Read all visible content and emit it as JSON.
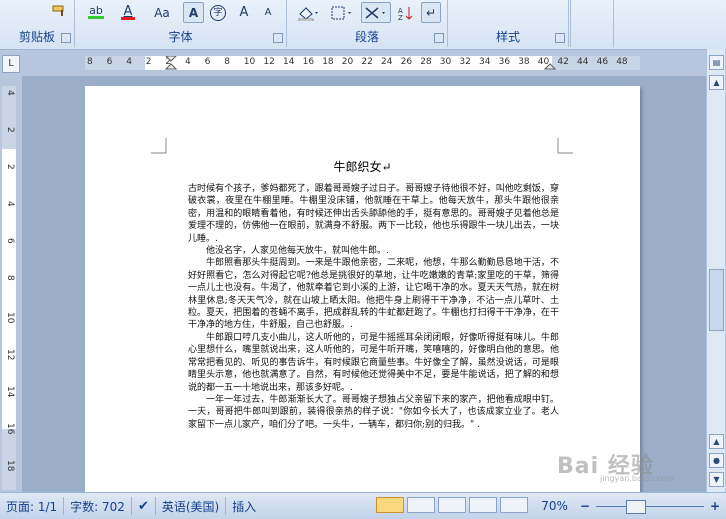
{
  "ribbon": {
    "groups": {
      "clipboard": "剪贴板",
      "font": "字体",
      "paragraph": "段落",
      "styles": "样式"
    },
    "font_buttons": {
      "highlight": "ab",
      "font_color": "A",
      "change_case": "Aa",
      "char_shading": "A",
      "enclose": "字",
      "grow": "A",
      "shrink": "A"
    }
  },
  "ruler": {
    "h_numbers": [
      "8",
      "6",
      "4",
      "2",
      "2",
      "4",
      "6",
      "8",
      "10",
      "12",
      "14",
      "16",
      "18",
      "20",
      "22",
      "24",
      "26",
      "28",
      "30",
      "32",
      "34",
      "36",
      "38",
      "40",
      "42",
      "44",
      "46",
      "48"
    ],
    "v_numbers": [
      "4",
      "2",
      "2",
      "4",
      "6",
      "8",
      "10",
      "12",
      "14",
      "16",
      "18"
    ],
    "corner_label": "L"
  },
  "document": {
    "title": "牛郎织女↵",
    "paragraphs": [
      "古时候有个孩子，爹妈都死了，跟着哥哥嫂子过日子。哥哥嫂子待他很不好，叫他吃剩饭，穿破衣裳，夜里在牛棚里睡。牛棚里没床铺，他就睡在干草上。他每天放牛，那头牛跟他很亲密，用温和的眼睛看着他，有时候还伸出舌头舔舔他的手，挺有意思的。哥哥嫂子见着他总是爱理不理的，仿佛他一在眼前，就满身不舒服。两下一比较，他也乐得跟牛一块儿出去，一块儿睡。.",
      "他没名字，人家见他每天放牛，就叫他牛郎。.",
      "牛郎照看那头牛挺周到。一来是牛跟他亲密，二来呢，他想，牛那么勤勤恳恳地干活，不好好照看它，怎么对得起它呢?他总是挑很好的草地，让牛吃嫩嫩的青草;家里吃的干草，筛得一点儿土也没有。牛渴了，他就牵着它到小溪的上游，让它喝干净的水。夏天天气热，就在树林里休息;冬天天气冷，就在山坡上晒太阳。他把牛身上刷得干干净净，不沾一点儿草叶、土粒。夏天，把围着的苍蝇不离手，把成群乱转的牛虻都赶跑了。牛棚也打扫得干干净净，在干干净净的地方住，牛舒服，自己也舒服。.",
      "牛郎跟口哼几支小曲儿，这人听他的，可是牛摇摇耳朵闭闭眼，好像听得挺有味儿。牛郎心里想什么，嘴里就说出来，这人听他的，可是牛听开嘴，笑嘻嘻的，好像明白他的意思。他常常把看见的、听见的事告诉牛，有时候跟它商量些事。牛好像全了解，虽然没说话，可是眼睛里头示意，他也就满意了。自然，有时候他还觉得美中不足，要是牛能说话，把了解的和想说的都一五一十地说出来，那该多好呢。.",
      "一年一年过去，牛郎渐渐长大了。哥哥嫂子想独占父亲留下来的家产，把他看成眼中钉。一天，哥哥把牛郎叫到跟前，装得很亲热的样子说：\"你如今长大了，也该成家立业了。老人家留下一点儿家产，咱们分了吧。一头牛，一辆车，都归你;别的归我。\" ."
    ]
  },
  "status_bar": {
    "page": "页面: 1/1",
    "words": "字数: 702",
    "language": "英语(美国)",
    "mode": "插入",
    "zoom": "70%",
    "zoom_minus": "−",
    "zoom_plus": "+"
  },
  "watermark": {
    "text": "Bai 经验",
    "url": "jingyan.baidu.com"
  }
}
